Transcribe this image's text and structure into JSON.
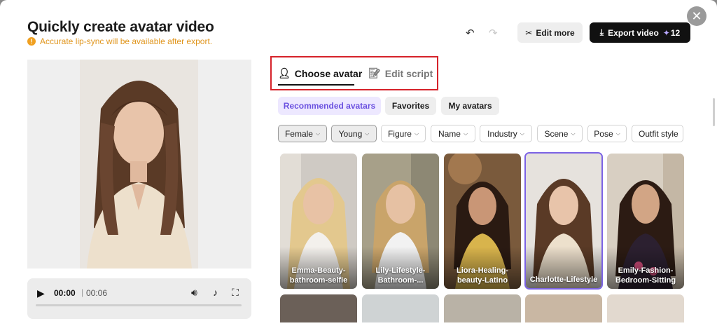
{
  "header": {
    "title": "Quickly create avatar video",
    "notice": "Accurate lip-sync will be available after export.",
    "edit_more_label": "Edit more",
    "export_label": "Export video",
    "export_credits": "12"
  },
  "player": {
    "current_time": "00:00",
    "separator": "|",
    "duration": "00:06",
    "progress": 0
  },
  "tabs": [
    {
      "label": "Choose avatar",
      "active": true
    },
    {
      "label": "Edit script",
      "active": false
    }
  ],
  "subtabs": [
    {
      "label": "Recommended avatars",
      "active": true
    },
    {
      "label": "Favorites",
      "active": false
    },
    {
      "label": "My avatars",
      "active": false
    }
  ],
  "filters": [
    {
      "label": "Female",
      "selected": true
    },
    {
      "label": "Young",
      "selected": true
    },
    {
      "label": "Figure",
      "selected": false
    },
    {
      "label": "Name",
      "selected": false
    },
    {
      "label": "Industry",
      "selected": false
    },
    {
      "label": "Scene",
      "selected": false
    },
    {
      "label": "Pose",
      "selected": false
    },
    {
      "label": "Outfit style",
      "selected": false
    }
  ],
  "avatars": [
    {
      "name": "Emma-Beauty-bathroom-selfie",
      "selected": false
    },
    {
      "name": "Lily-Lifestyle-Bathroom-...",
      "selected": false
    },
    {
      "name": "Liora-Healing-beauty-Latino",
      "selected": false
    },
    {
      "name": "Charlotte-Lifestyle",
      "selected": true
    },
    {
      "name": "Emily-Fashion-Bedroom-Sitting",
      "selected": false
    }
  ],
  "colors": {
    "accent": "#7b62e4",
    "warning": "#e0951c",
    "highlight_box": "#d6222a"
  }
}
